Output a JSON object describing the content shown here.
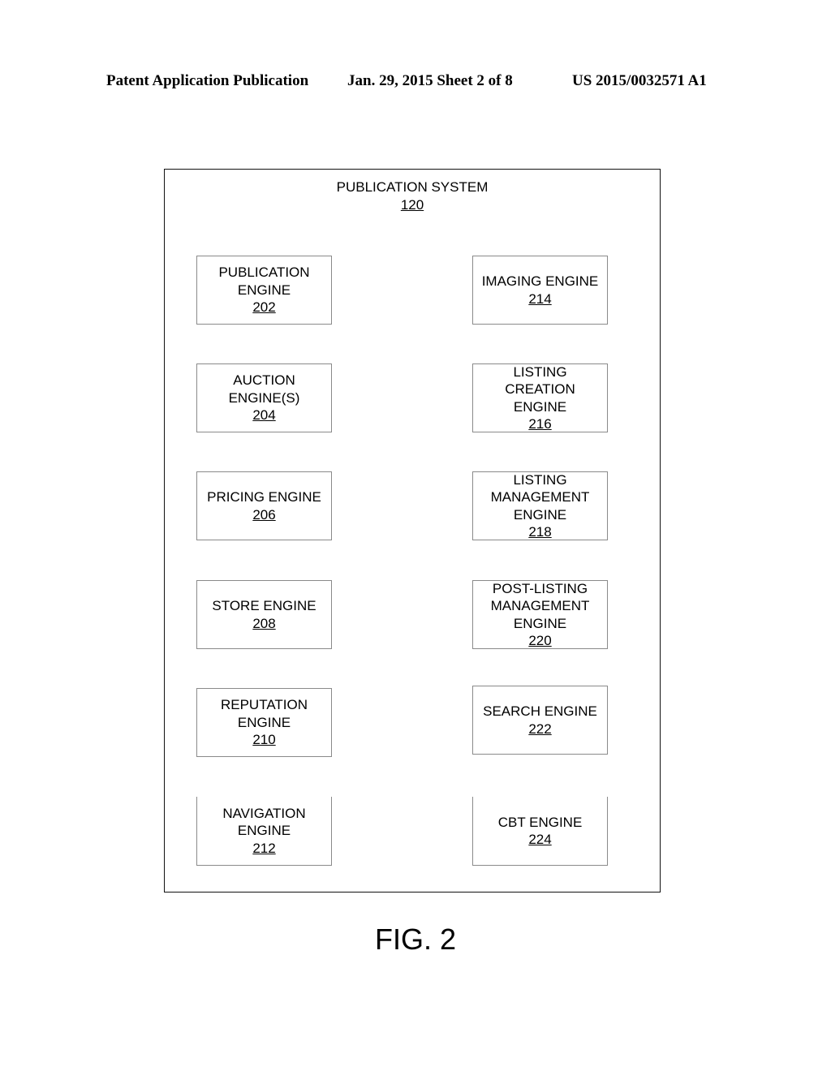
{
  "header": {
    "publication_type": "Patent Application Publication",
    "date_sheet": "Jan. 29, 2015  Sheet 2 of 8",
    "publication_number": "US 2015/0032571 A1"
  },
  "system": {
    "title": "PUBLICATION SYSTEM",
    "ref": "120"
  },
  "left_column": [
    {
      "lines": [
        "PUBLICATION",
        "ENGINE"
      ],
      "ref": "202"
    },
    {
      "lines": [
        "AUCTION",
        "ENGINE(S)"
      ],
      "ref": "204"
    },
    {
      "lines": [
        "PRICING ENGINE"
      ],
      "ref": "206"
    },
    {
      "lines": [
        "STORE ENGINE"
      ],
      "ref": "208"
    },
    {
      "lines": [
        "REPUTATION",
        "ENGINE"
      ],
      "ref": "210"
    },
    {
      "lines": [
        "NAVIGATION",
        "ENGINE"
      ],
      "ref": "212"
    }
  ],
  "right_column": [
    {
      "lines": [
        "IMAGING ENGINE"
      ],
      "ref": "214"
    },
    {
      "lines": [
        "LISTING",
        "CREATION",
        "ENGINE"
      ],
      "ref": "216"
    },
    {
      "lines": [
        "LISTING",
        "MANAGEMENT",
        "ENGINE"
      ],
      "ref": "218"
    },
    {
      "lines": [
        "POST-LISTING",
        "MANAGEMENT",
        "ENGINE"
      ],
      "ref": "220"
    },
    {
      "lines": [
        "SEARCH ENGINE"
      ],
      "ref": "222"
    },
    {
      "lines": [
        "CBT ENGINE"
      ],
      "ref": "224"
    }
  ],
  "figure_label": "FIG. 2"
}
